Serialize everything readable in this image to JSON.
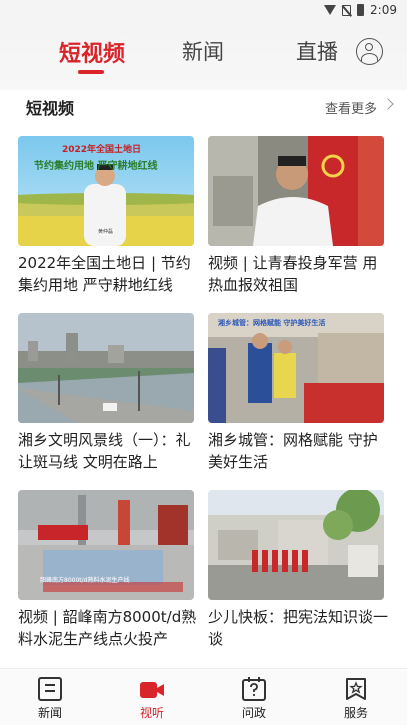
{
  "status_bar": {
    "time": "2:09"
  },
  "top_tabs": [
    {
      "label": "短视频",
      "active": true
    },
    {
      "label": "新闻",
      "active": false
    },
    {
      "label": "直播",
      "active": false
    }
  ],
  "section": {
    "title": "短视频",
    "more": "查看更多"
  },
  "cards": [
    {
      "title": "2022年全国土地日 | 节约集约用地 严守耕地红线",
      "thumb_caption": "2022年全国土地日",
      "thumb_subtitle": "节约集约用地 严守耕地红线",
      "thumb_name": "黄仲磊"
    },
    {
      "title": "视频 | 让青春投身军营 用热血报效祖国"
    },
    {
      "title": "湘乡文明风景线（一）：礼让斑马线 文明在路上"
    },
    {
      "title": "湘乡城管：网格赋能 守护美好生活",
      "thumb_caption": "湘乡城管：网格赋能 守护美好生活"
    },
    {
      "title": "视频 | 韶峰南方8000t/d熟料水泥生产线点火投产",
      "thumb_caption": "韶峰南方8000t/d熟料水泥生产线"
    },
    {
      "title": "少儿快板：把宪法知识谈一谈"
    }
  ],
  "bottom_nav": [
    {
      "label": "新闻",
      "icon": "news-icon",
      "active": false
    },
    {
      "label": "视听",
      "icon": "video-icon",
      "active": true
    },
    {
      "label": "问政",
      "icon": "question-calendar-icon",
      "active": false
    },
    {
      "label": "服务",
      "icon": "star-service-icon",
      "active": false
    }
  ],
  "colors": {
    "accent": "#d9242a",
    "text": "#222222",
    "muted": "#555555"
  }
}
